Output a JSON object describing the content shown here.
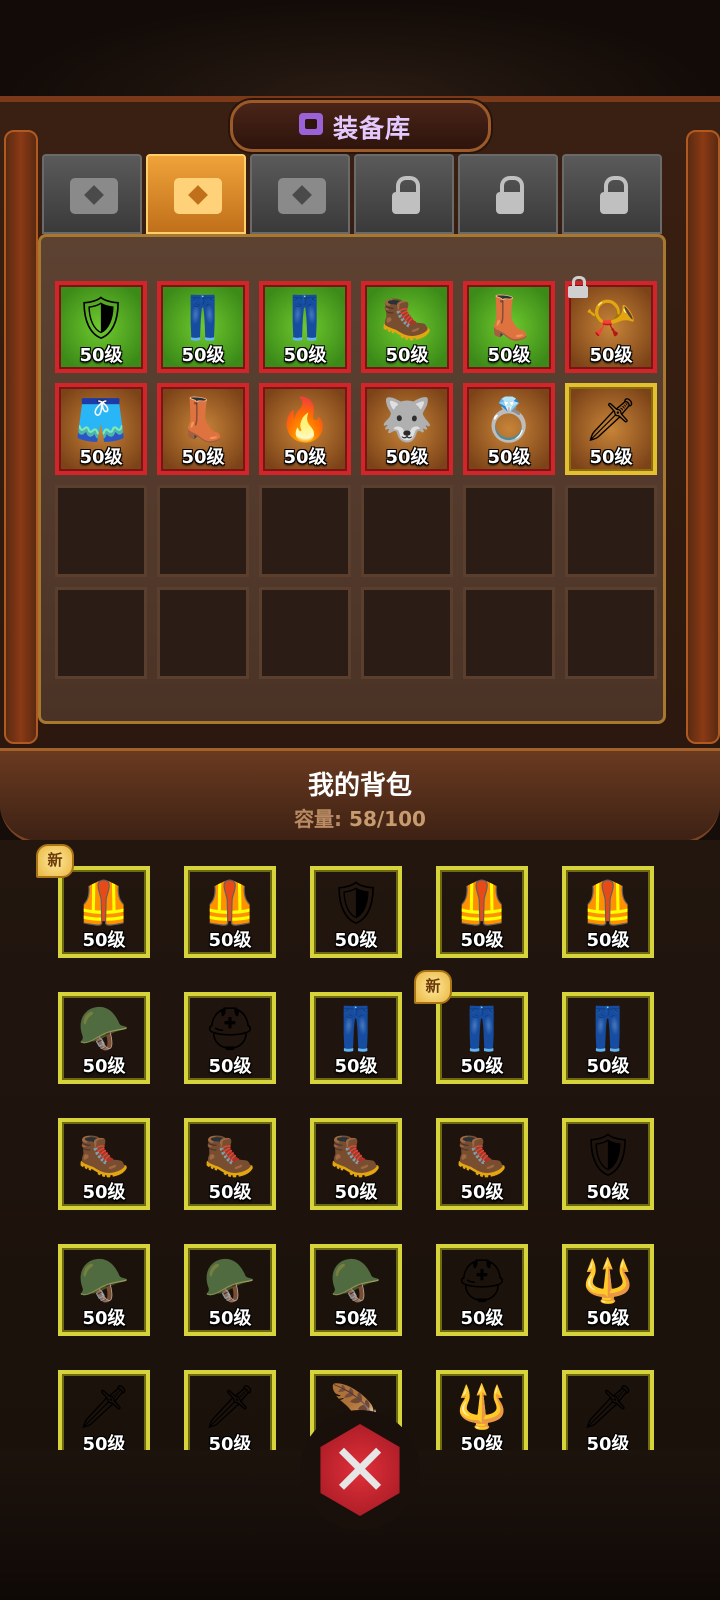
{
  "title": {
    "text": "装备库",
    "icon": "chest-icon"
  },
  "tabs": [
    {
      "state": "unlocked",
      "icon": "chest-icon"
    },
    {
      "state": "active",
      "icon": "chest-icon"
    },
    {
      "state": "unlocked",
      "icon": "chest-icon"
    },
    {
      "state": "locked",
      "icon": "lock-icon"
    },
    {
      "state": "locked",
      "icon": "lock-icon"
    },
    {
      "state": "locked",
      "icon": "lock-icon"
    }
  ],
  "storage": {
    "items": [
      {
        "name": "blue-shoulder-armor",
        "level": "50级",
        "quality": "green"
      },
      {
        "name": "dark-gold-pants",
        "level": "50级",
        "quality": "green"
      },
      {
        "name": "dark-gold-pants",
        "level": "50级",
        "quality": "green"
      },
      {
        "name": "dark-spiked-boots",
        "level": "50级",
        "quality": "green"
      },
      {
        "name": "white-gold-boots",
        "level": "50级",
        "quality": "green"
      },
      {
        "name": "war-horn",
        "level": "50级",
        "quality": "orange",
        "locked": true
      },
      {
        "name": "red-white-pants",
        "level": "50级",
        "quality": "orange"
      },
      {
        "name": "winged-gold-boots",
        "level": "50级",
        "quality": "orange"
      },
      {
        "name": "fire-chest-armor",
        "level": "50级",
        "quality": "orange"
      },
      {
        "name": "wolf-pendant",
        "level": "50级",
        "quality": "orange"
      },
      {
        "name": "gold-ring",
        "level": "50级",
        "quality": "orange"
      },
      {
        "name": "sword",
        "level": "50级",
        "quality": "orange",
        "border": "gold"
      }
    ],
    "empty_slots": 12
  },
  "bag": {
    "title": "我的背包",
    "capacity_label": "容量:",
    "capacity_value": "58/100",
    "new_label": "新",
    "items": [
      {
        "name": "bronze-chest-armor",
        "level": "50级",
        "new": true
      },
      {
        "name": "green-chest-armor",
        "level": "50级"
      },
      {
        "name": "blue-shoulder-armor",
        "level": "50级"
      },
      {
        "name": "purple-chest-armor",
        "level": "50级"
      },
      {
        "name": "purple-chest-armor",
        "level": "50级"
      },
      {
        "name": "horned-helmet",
        "level": "50级"
      },
      {
        "name": "plumed-helmet",
        "level": "50级"
      },
      {
        "name": "green-pants",
        "level": "50级"
      },
      {
        "name": "royal-pants",
        "level": "50级",
        "new": true
      },
      {
        "name": "royal-pants",
        "level": "50级"
      },
      {
        "name": "dark-spiked-boots",
        "level": "50级"
      },
      {
        "name": "dark-spiked-boots",
        "level": "50级"
      },
      {
        "name": "green-boots",
        "level": "50级"
      },
      {
        "name": "green-boots",
        "level": "50级"
      },
      {
        "name": "fur-shoulder-armor",
        "level": "50级"
      },
      {
        "name": "green-helmet",
        "level": "50级"
      },
      {
        "name": "blue-helmet",
        "level": "50级"
      },
      {
        "name": "purple-helmet",
        "level": "50级"
      },
      {
        "name": "gold-helmet",
        "level": "50级"
      },
      {
        "name": "purple-mace",
        "level": "50级",
        "quality": "orange"
      },
      {
        "name": "sword",
        "level": "50级",
        "quality": "orange"
      },
      {
        "name": "sword",
        "level": "50级",
        "quality": "orange"
      },
      {
        "name": "feather-weapon",
        "level": "50级",
        "quality": "orange"
      },
      {
        "name": "gold-scepter",
        "level": "50级",
        "quality": "orange"
      },
      {
        "name": "green-sword",
        "level": "50级",
        "quality": "green"
      }
    ]
  },
  "close_button": {
    "icon": "close-icon"
  },
  "colors": {
    "green_quality": "#4fa51f",
    "orange_quality": "#9c5a22",
    "red_border": "#d1252a",
    "yellow_border": "#d7d33a"
  }
}
